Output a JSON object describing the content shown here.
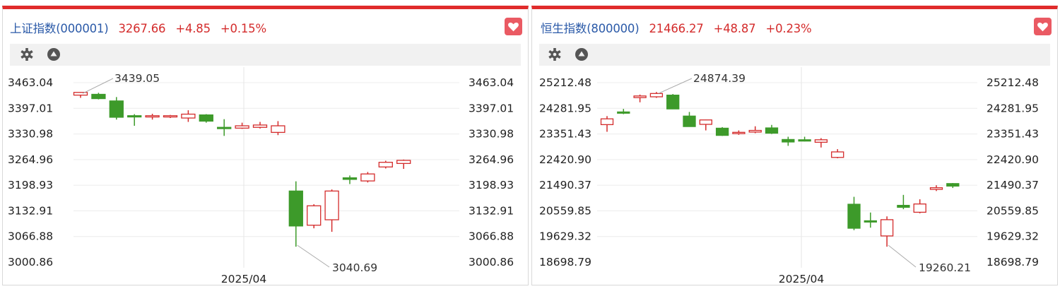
{
  "panels": [
    {
      "name": "上证指数(000001)",
      "price": "3267.66",
      "change": "+4.85",
      "pct": "+0.15%",
      "icons": [
        "gear-icon",
        "triangle-up-icon",
        "heart-icon"
      ],
      "colors": {
        "up": "#d42c2c",
        "down": "#3d9a2a",
        "name": "#2b5aa8",
        "top_border": "#e02b2b",
        "fav": "#ea5a63"
      }
    },
    {
      "name": "恒生指数(800000)",
      "price": "21466.27",
      "change": "+48.87",
      "pct": "+0.23%",
      "icons": [
        "gear-icon",
        "triangle-up-icon",
        "heart-icon"
      ],
      "colors": {
        "up": "#d42c2c",
        "down": "#3d9a2a",
        "name": "#2b5aa8",
        "top_border": "#e02b2b",
        "fav": "#ea5a63"
      }
    }
  ],
  "chart_data": [
    {
      "type": "candlestick",
      "y_ticks": [
        "3463.04",
        "3397.01",
        "3330.98",
        "3264.96",
        "3198.93",
        "3132.91",
        "3066.88",
        "3000.86"
      ],
      "ylim": [
        3000.86,
        3463.04
      ],
      "x_tick_label": "2025/04",
      "x_tick_after_index": 9,
      "grid": true,
      "high_label": "3439.05",
      "low_label": "3040.69",
      "high_index": 0,
      "low_index": 12,
      "candles": [
        {
          "o": 3431,
          "h": 3439.05,
          "l": 3424,
          "c": 3438
        },
        {
          "o": 3433,
          "h": 3437,
          "l": 3420,
          "c": 3422
        },
        {
          "o": 3416,
          "h": 3426,
          "l": 3368,
          "c": 3374
        },
        {
          "o": 3378,
          "h": 3382,
          "l": 3352,
          "c": 3376
        },
        {
          "o": 3377,
          "h": 3383,
          "l": 3368,
          "c": 3378
        },
        {
          "o": 3375,
          "h": 3380,
          "l": 3372,
          "c": 3378
        },
        {
          "o": 3372,
          "h": 3392,
          "l": 3362,
          "c": 3382
        },
        {
          "o": 3380,
          "h": 3382,
          "l": 3360,
          "c": 3364
        },
        {
          "o": 3348,
          "h": 3369,
          "l": 3326,
          "c": 3345
        },
        {
          "o": 3346,
          "h": 3360,
          "l": 3344,
          "c": 3352
        },
        {
          "o": 3348,
          "h": 3362,
          "l": 3345,
          "c": 3354
        },
        {
          "o": 3335,
          "h": 3364,
          "l": 3328,
          "c": 3352
        },
        {
          "o": 3184,
          "h": 3209,
          "l": 3040.69,
          "c": 3094
        },
        {
          "o": 3096,
          "h": 3150,
          "l": 3088,
          "c": 3146
        },
        {
          "o": 3110,
          "h": 3188,
          "l": 3079,
          "c": 3184
        },
        {
          "o": 3218,
          "h": 3224,
          "l": 3202,
          "c": 3214
        },
        {
          "o": 3210,
          "h": 3233,
          "l": 3206,
          "c": 3228
        },
        {
          "o": 3246,
          "h": 3262,
          "l": 3242,
          "c": 3258
        },
        {
          "o": 3255,
          "h": 3265,
          "l": 3241,
          "c": 3263
        }
      ]
    },
    {
      "type": "candlestick",
      "y_ticks": [
        "25212.48",
        "24281.95",
        "23351.43",
        "22420.90",
        "21490.37",
        "20559.85",
        "19629.32",
        "18698.79"
      ],
      "ylim": [
        18698.79,
        25212.48
      ],
      "x_tick_label": "2025/04",
      "x_tick_after_index": 11,
      "grid": true,
      "high_label": "24874.39",
      "low_label": "19260.21",
      "high_index": 3,
      "low_index": 17,
      "candles": [
        {
          "o": 23690,
          "h": 24000,
          "l": 23430,
          "c": 23900
        },
        {
          "o": 24150,
          "h": 24260,
          "l": 24070,
          "c": 24110
        },
        {
          "o": 24670,
          "h": 24780,
          "l": 24500,
          "c": 24730
        },
        {
          "o": 24700,
          "h": 24874.39,
          "l": 24660,
          "c": 24820
        },
        {
          "o": 24760,
          "h": 24800,
          "l": 24250,
          "c": 24260
        },
        {
          "o": 24000,
          "h": 24150,
          "l": 23610,
          "c": 23620
        },
        {
          "o": 23700,
          "h": 23870,
          "l": 23480,
          "c": 23860
        },
        {
          "o": 23560,
          "h": 23600,
          "l": 23280,
          "c": 23300
        },
        {
          "o": 23400,
          "h": 23480,
          "l": 23320,
          "c": 23410
        },
        {
          "o": 23420,
          "h": 23630,
          "l": 23380,
          "c": 23480
        },
        {
          "o": 23570,
          "h": 23680,
          "l": 23350,
          "c": 23380
        },
        {
          "o": 23150,
          "h": 23250,
          "l": 22920,
          "c": 23060
        },
        {
          "o": 23140,
          "h": 23250,
          "l": 23080,
          "c": 23100
        },
        {
          "o": 23050,
          "h": 23200,
          "l": 22860,
          "c": 23140
        },
        {
          "o": 22500,
          "h": 22800,
          "l": 22470,
          "c": 22700
        },
        {
          "o": 20800,
          "h": 21070,
          "l": 19860,
          "c": 19930
        },
        {
          "o": 20200,
          "h": 20500,
          "l": 19950,
          "c": 20170
        },
        {
          "o": 19650,
          "h": 20360,
          "l": 19260.21,
          "c": 20240
        },
        {
          "o": 20760,
          "h": 21140,
          "l": 20620,
          "c": 20690
        },
        {
          "o": 20510,
          "h": 20980,
          "l": 20470,
          "c": 20810
        },
        {
          "o": 21340,
          "h": 21490,
          "l": 21280,
          "c": 21400
        },
        {
          "o": 21550,
          "h": 21570,
          "l": 21390,
          "c": 21460
        }
      ]
    }
  ]
}
